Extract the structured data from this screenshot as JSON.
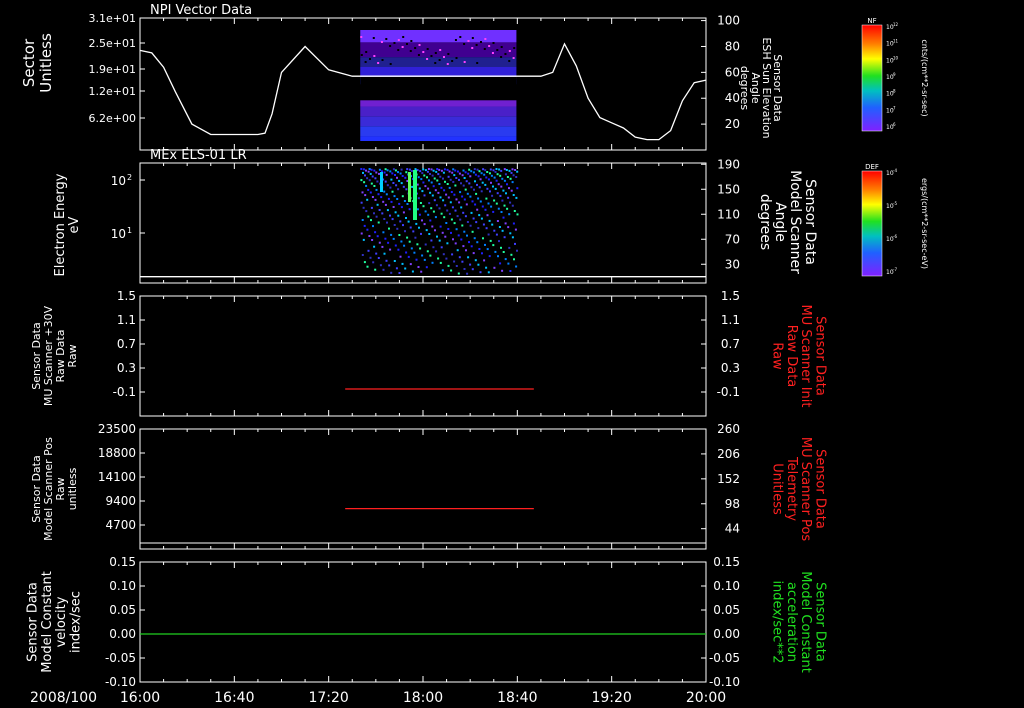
{
  "chart_data": [
    {
      "type": "line",
      "panel_title": "NPI Vector Data",
      "ylabel_left": [
        "Sector",
        "Unitless"
      ],
      "yticks_left": [
        "3.1e+01",
        "2.5e+01",
        "1.9e+01",
        "1.2e+01",
        "6.2e+00"
      ],
      "ylabel_right": [
        "Sensor Data",
        "ESH Sun Elevation",
        "Angle",
        "degrees"
      ],
      "yticks_right": [
        "100",
        "80",
        "60",
        "40",
        "20"
      ],
      "ylim_right": [
        0,
        100
      ],
      "line_series": {
        "name": "",
        "color": "#ffffff",
        "x_minutes": [
          0,
          5,
          10,
          15,
          22,
          30,
          40,
          47,
          50,
          53,
          56,
          60,
          70,
          80,
          90,
          95,
          100,
          103,
          106,
          110,
          115,
          120,
          125,
          130,
          135,
          140,
          145,
          150,
          155,
          160,
          165,
          170,
          175,
          180,
          185,
          190,
          195,
          200,
          205,
          210,
          215,
          220,
          225,
          230,
          235,
          240
        ],
        "y": [
          77,
          75,
          64,
          45,
          20,
          12,
          12,
          12,
          12,
          13,
          28,
          60,
          80,
          62,
          57,
          57,
          57,
          57,
          57,
          57,
          57,
          57,
          57,
          57,
          57,
          57,
          57,
          57,
          57,
          57,
          57,
          57,
          60,
          82,
          65,
          40,
          25,
          21,
          17,
          10,
          8,
          8,
          15,
          38,
          52,
          54
        ]
      },
      "spectrogram": {
        "x_start_minutes": 90,
        "x_end_minutes": 163,
        "bands": [
          {
            "from": 0,
            "to": 4,
            "color": "#2232ff"
          },
          {
            "from": 4,
            "to": 12,
            "color": "#2a3bf0"
          },
          {
            "from": 12,
            "to": 20,
            "color": "#3a2bd8"
          },
          {
            "from": 20,
            "to": 28,
            "color": "#4a20c8"
          },
          {
            "from": 28,
            "to": 33,
            "color": "#7020d0"
          },
          {
            "from": 46,
            "to": 50,
            "color": "#1a2fff"
          },
          {
            "from": 50,
            "to": 60,
            "color": "#3020d8"
          },
          {
            "from": 60,
            "to": 68,
            "color": "#202090"
          },
          {
            "from": 68,
            "to": 80,
            "color": "#400090"
          },
          {
            "from": 80,
            "to": 90,
            "color": "#7030ff"
          }
        ]
      },
      "colorbar": {
        "label": "NF",
        "unit": "cnts/(cm**2-sr-sec)",
        "ticks": [
          "10",
          "10",
          "10",
          "10",
          "10",
          "10",
          "10"
        ],
        "exponents": [
          "12",
          "11",
          "10",
          "9",
          "8",
          "7",
          "6"
        ]
      }
    },
    {
      "type": "heatmap",
      "panel_title": "MEx ELS-01 LR",
      "ylabel_left": [
        "Electron Energy",
        "eV"
      ],
      "yticks_left": [
        "10",
        "10"
      ],
      "yticks_left_exp": [
        "2",
        "1"
      ],
      "ylabel_right": [
        "Sensor Data",
        "Model Scanner",
        "Angle",
        "degrees"
      ],
      "yticks_right": [
        "190",
        "150",
        "110",
        "70",
        "30"
      ],
      "ylim_right": [
        0,
        190
      ],
      "line_series": {
        "name": "",
        "color": "#ffffff",
        "x_minutes": [
          0,
          240
        ],
        "y": [
          10,
          10
        ]
      },
      "spectrogram": {
        "x_start_minutes": 90,
        "x_end_minutes": 165
      },
      "colorbar": {
        "label": "DEF",
        "unit": "ergs/(cm**2-sr-sec-eV)",
        "ticks": [
          "10",
          "10",
          "10",
          "10"
        ],
        "exponents": [
          "-4",
          "-5",
          "-6",
          "-7"
        ]
      }
    },
    {
      "type": "line",
      "ylabel_left": [
        "Sensor Data",
        "MU Scanner +30V",
        "Raw Data",
        "Raw"
      ],
      "yticks_left": [
        "1.5",
        "1.1",
        "0.7",
        "0.3",
        "-0.1"
      ],
      "ylim": [
        -0.5,
        1.5
      ],
      "ylabel_right": [
        "Sensor Data",
        "MU Scanner Init",
        "Raw Data",
        "Raw"
      ],
      "ylabel_right_color": "#ff2020",
      "yticks_right": [
        "1.5",
        "1.1",
        "0.7",
        "0.3",
        "-0.1"
      ],
      "series": [
        {
          "name": "",
          "color": "#ff2020",
          "x_minutes": [
            87,
            167
          ],
          "y": [
            -0.05,
            -0.05
          ]
        }
      ]
    },
    {
      "type": "line",
      "ylabel_left": [
        "Sensor Data",
        "Model Scanner Pos",
        "Raw",
        "unitless"
      ],
      "yticks_left": [
        "23500",
        "18800",
        "14100",
        "9400",
        "4700"
      ],
      "ylim": [
        0,
        23500
      ],
      "ylabel_right": [
        "Sensor Data",
        "MU Scanner Pos",
        "Telemetry",
        "Unitless"
      ],
      "ylabel_right_color": "#ff2020",
      "yticks_right": [
        "260",
        "206",
        "152",
        "98",
        "44"
      ],
      "series": [
        {
          "name": "",
          "color": "#ff2020",
          "x_minutes": [
            87,
            167
          ],
          "y": [
            7900,
            7900
          ]
        }
      ]
    },
    {
      "type": "line",
      "ylabel_left": [
        "Sensor Data",
        "Model Constant",
        "velocity",
        "index/sec"
      ],
      "yticks_left": [
        "0.15",
        "0.10",
        "0.05",
        "0.00",
        "-0.05",
        "-0.10"
      ],
      "ylim": [
        -0.1,
        0.15
      ],
      "ylabel_right": [
        "Sensor Data",
        "Model Constant",
        "acceleration",
        "index/sec**2"
      ],
      "ylabel_right_color": "#20e020",
      "yticks_right": [
        "0.15",
        "0.10",
        "0.05",
        "0.00",
        "-0.05",
        "-0.10"
      ],
      "series": [
        {
          "name": "",
          "color": "#20d020",
          "x_minutes": [
            0,
            240
          ],
          "y": [
            0,
            0
          ]
        }
      ]
    }
  ],
  "x_axis": {
    "date_label": "2008/100",
    "ticks": [
      "16:00",
      "16:40",
      "17:20",
      "18:00",
      "18:40",
      "19:20",
      "20:00"
    ],
    "range_minutes": [
      0,
      240
    ]
  }
}
